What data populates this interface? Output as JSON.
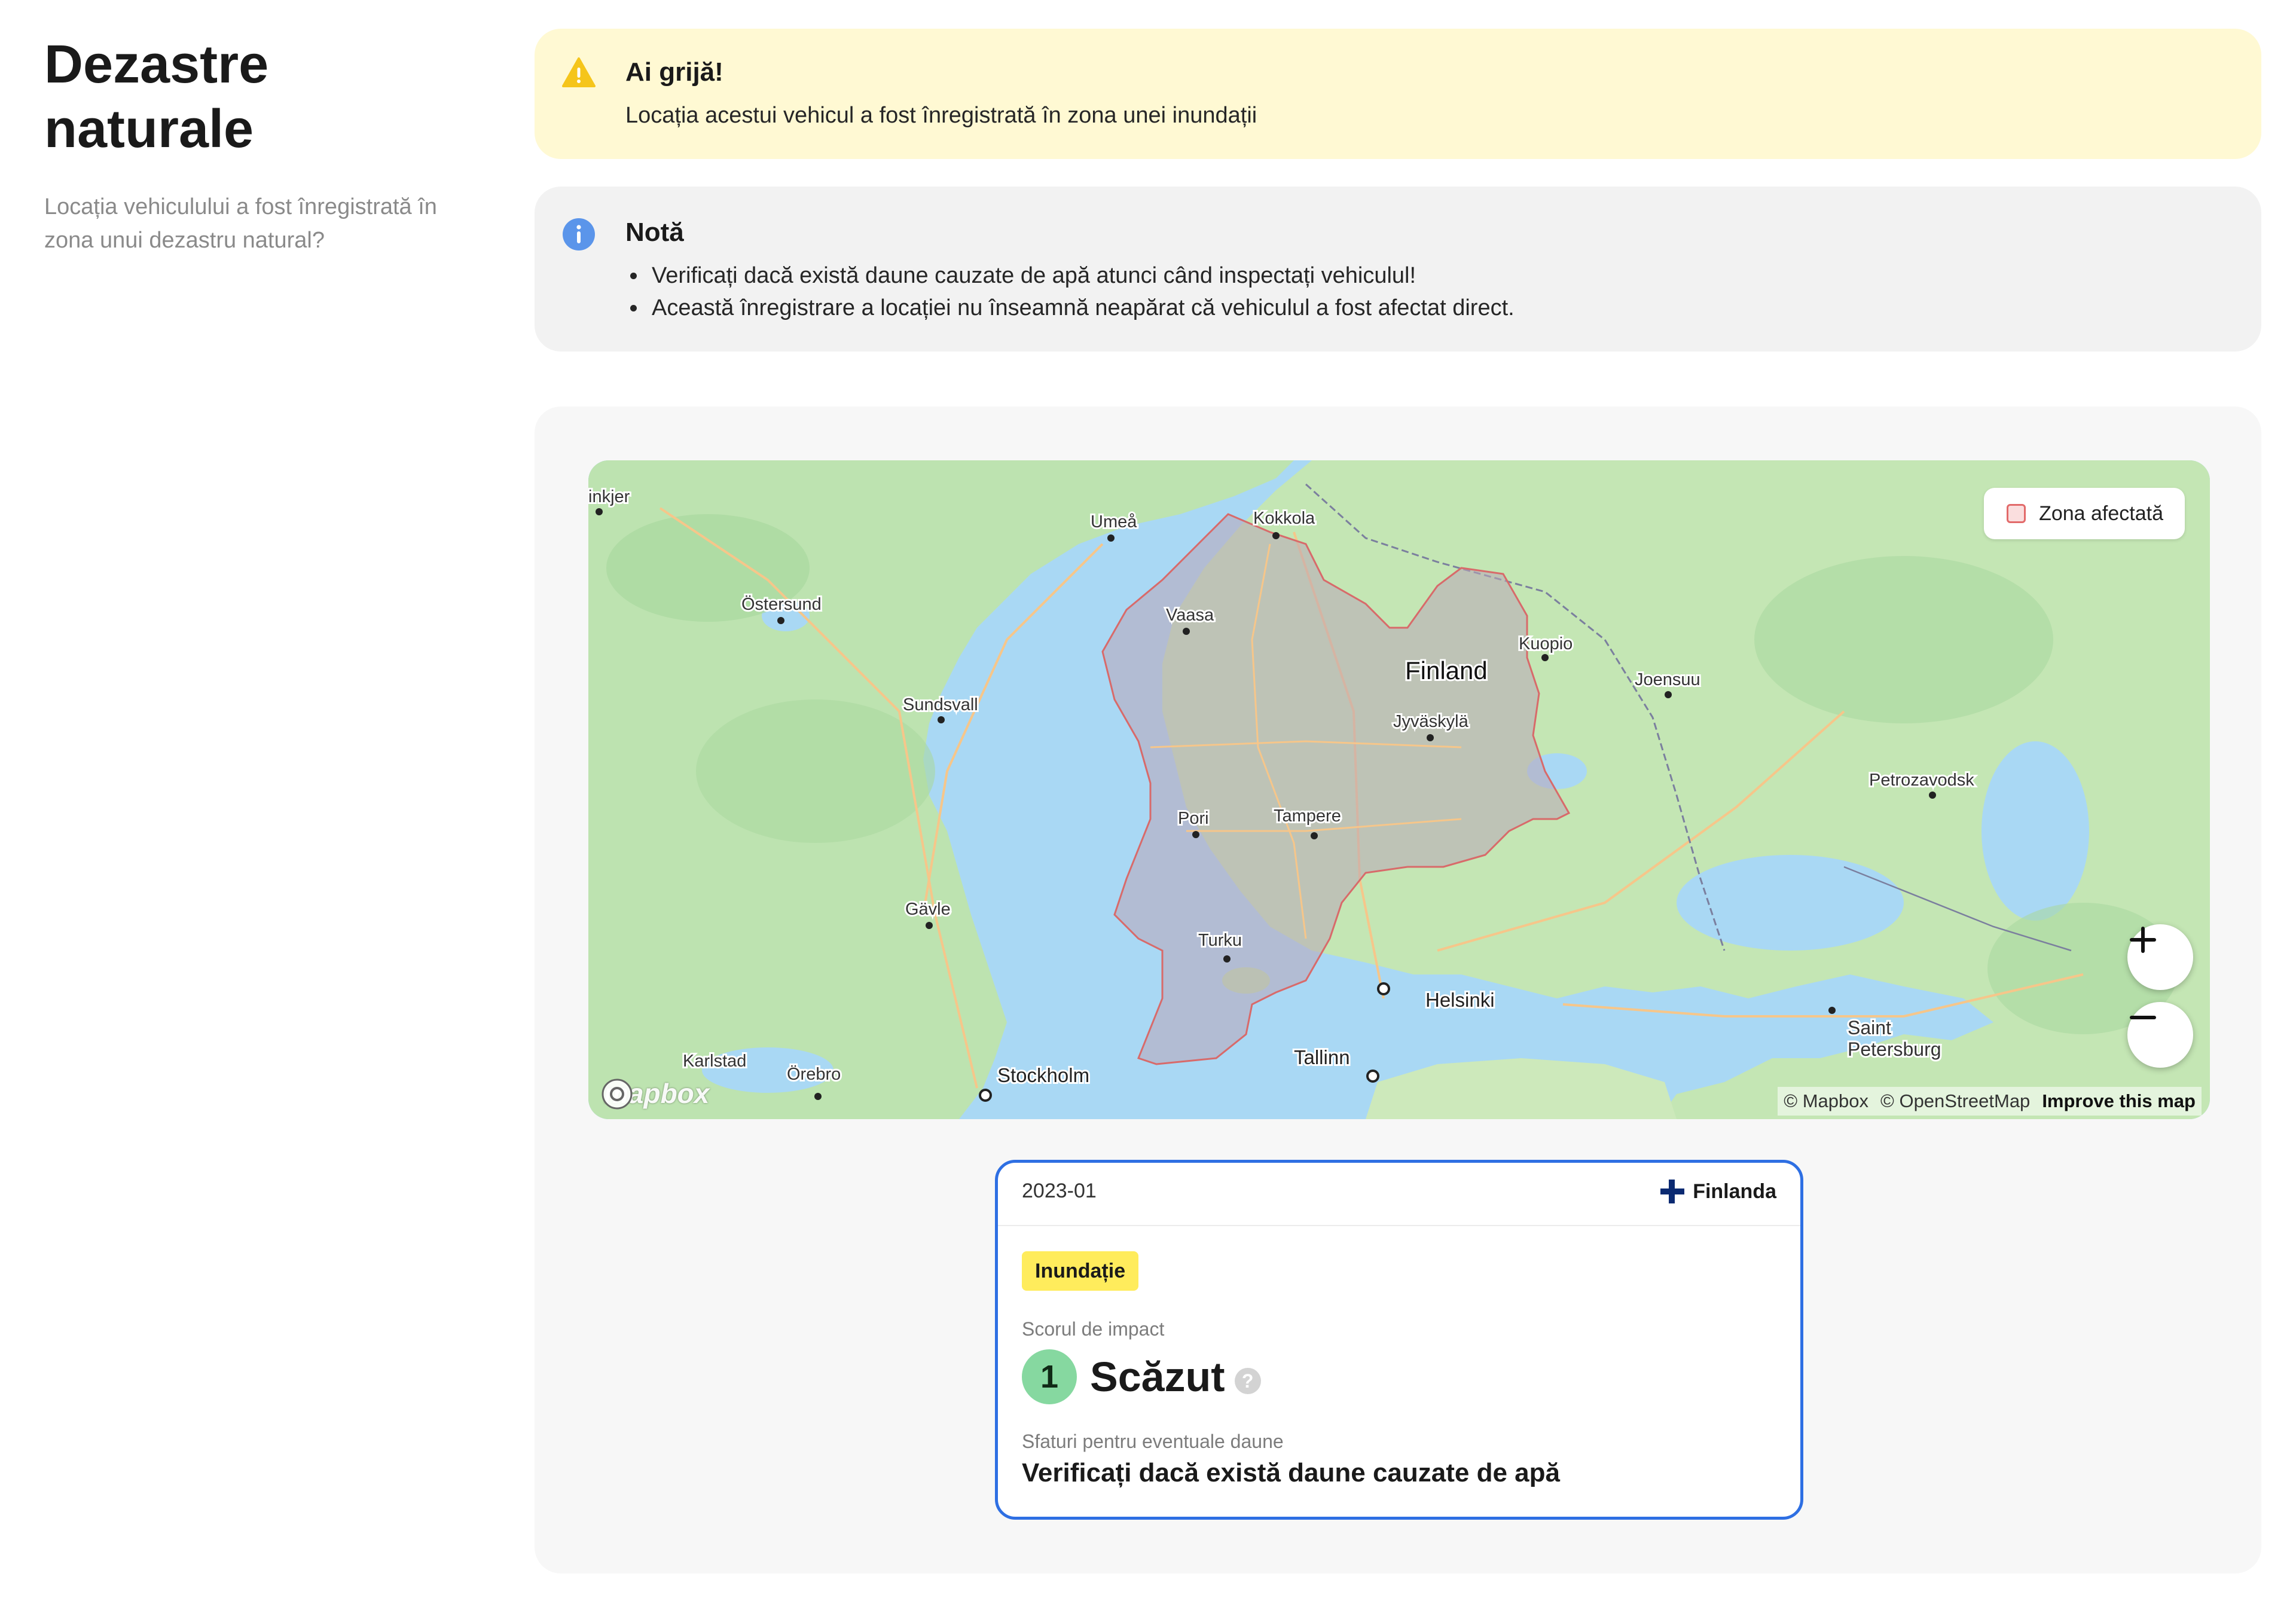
{
  "section": {
    "title": "Dezastre naturale",
    "subtitle": "Locația vehiculului a fost înregistrată în zona unui dezastru natural?"
  },
  "warning": {
    "title": "Ai grijă!",
    "text": "Locația acestui vehicul a fost înregistrată în zona unei inundații",
    "icon": "warning-triangle-icon",
    "color": "#f5c51b"
  },
  "note": {
    "title": "Notă",
    "icon": "info-circle-icon",
    "color": "#3a7ee0",
    "items": [
      "Verificați dacă există daune cauzate de apă atunci când inspectați vehiculul!",
      "Această înregistrare a locației nu înseamnă neapărat că vehiculul a fost afectat direct."
    ]
  },
  "map": {
    "legend_label": "Zona afectată",
    "country_label": "Finland",
    "cities": {
      "kokkola": "Kokkola",
      "umea": "Umeå",
      "ostersund": "Östersund",
      "vaasa": "Vaasa",
      "kuopio": "Kuopio",
      "joensuu": "Joensuu",
      "sundsvall": "Sundsvall",
      "jyvaskyla": "Jyväskylä",
      "petrozavodsk": "Petrozavodsk",
      "pori": "Pori",
      "tampere": "Tampere",
      "gavle": "Gävle",
      "turku": "Turku",
      "helsinki": "Helsinki",
      "saint_petersburg_1": "Saint",
      "saint_petersburg_2": "Petersburg",
      "karlstad": "Karlstad",
      "orebro": "Örebro",
      "stockholm": "Stockholm",
      "tallinn": "Tallinn",
      "edge_left": "inkjer"
    },
    "attribution": {
      "mapbox": "© Mapbox",
      "osm": "© OpenStreetMap",
      "improve": "Improve this map"
    },
    "logo_text": "mapbox",
    "zoom_in_icon": "plus-icon",
    "zoom_out_icon": "minus-icon",
    "zone_color": "#e26a6a"
  },
  "event": {
    "date": "2023-01",
    "country": "Finlanda",
    "type": "Inundație",
    "impact_label": "Scorul de impact",
    "score": "1",
    "score_text": "Scăzut",
    "help": "?",
    "advice_label": "Sfaturi pentru eventuale daune",
    "advice": "Verificați dacă există daune cauzate de apă",
    "badge_color": "#ffec5c",
    "score_color": "#86d8a0",
    "border_color": "#2e6fe3"
  }
}
